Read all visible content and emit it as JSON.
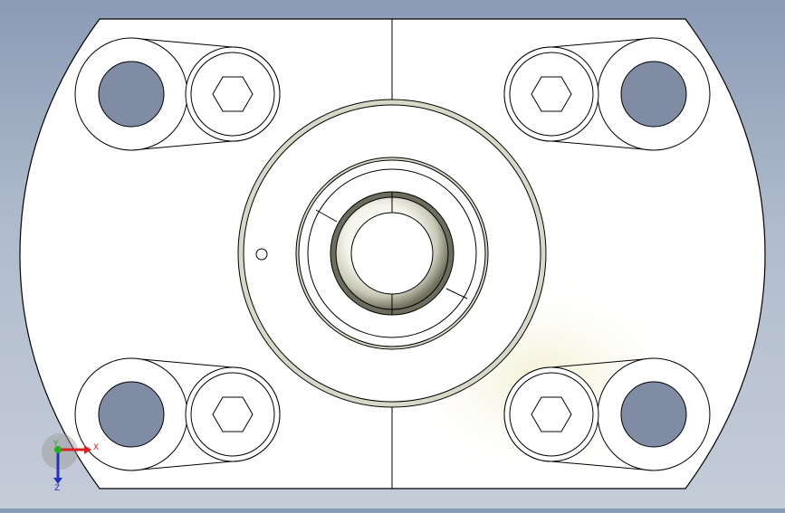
{
  "viewport": {
    "background_top": "#8a9bb5",
    "background_bottom": "#c4ccd8",
    "part_fill": "#ffffff",
    "edge_color": "#000000",
    "highlight_color": "#f6f3dc"
  },
  "triad": {
    "x_label": "X",
    "y_label": "Y",
    "z_label": "Z",
    "x_color": "#e02020",
    "y_color": "#20b020",
    "z_color": "#2030c0"
  }
}
